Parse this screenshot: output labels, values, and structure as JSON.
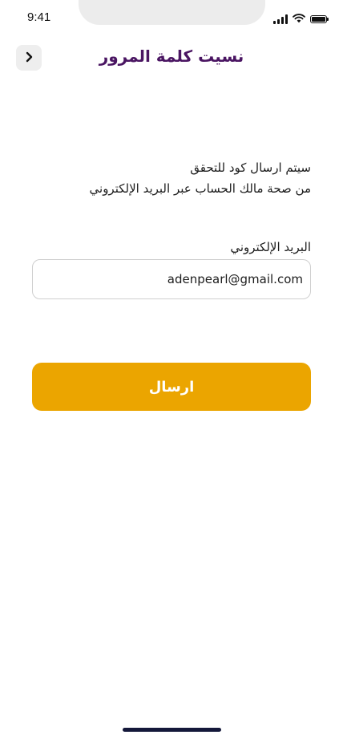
{
  "status_bar": {
    "time": "9:41",
    "icons": [
      "cellular-signal-icon",
      "wifi-icon",
      "battery-icon"
    ]
  },
  "header": {
    "back_icon": "chevron-left-icon",
    "title": "نسيت كلمة المرور"
  },
  "description": {
    "line1": "سيتم ارسال كود للتحقق",
    "line2": "من صحة مالك الحساب عبر البريد الإلكتروني"
  },
  "email_field": {
    "label": "البريد الإلكتروني",
    "value": "adenpearl@gmail.com"
  },
  "submit_button": {
    "label": "ارسال"
  },
  "colors": {
    "title": "#4a1562",
    "button": "#eba500",
    "back_button_bg": "#eeeeee",
    "home_indicator": "#14183a"
  }
}
